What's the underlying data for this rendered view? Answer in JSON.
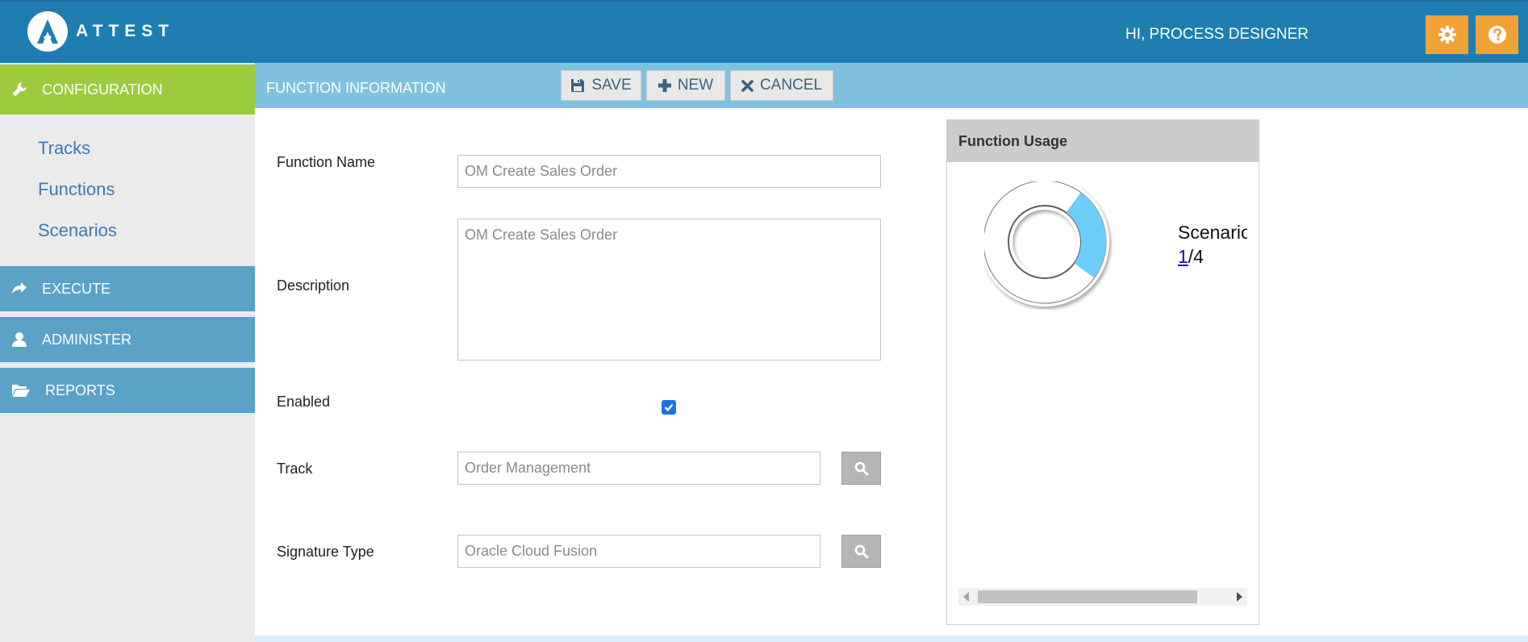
{
  "header": {
    "brand": "ATTEST",
    "greeting": "HI, PROCESS DESIGNER",
    "settings_icon": "gear-icon",
    "help_icon": "help-icon"
  },
  "sidebar": {
    "configuration": "CONFIGURATION",
    "links": [
      "Tracks",
      "Functions",
      "Scenarios"
    ],
    "execute": "EXECUTE",
    "administer": "ADMINISTER",
    "reports": "REPORTS"
  },
  "toolbar": {
    "title": "FUNCTION INFORMATION",
    "save": "SAVE",
    "new": "NEW",
    "cancel": "CANCEL"
  },
  "form": {
    "function_name_label": "Function Name",
    "function_name_value": "OM Create Sales Order",
    "description_label": "Description",
    "description_value": "OM Create Sales Order",
    "enabled_label": "Enabled",
    "enabled": true,
    "track_label": "Track",
    "track_value": "Order Management",
    "signature_label": "Signature Type",
    "signature_value": "Oracle Cloud Fusion"
  },
  "usage": {
    "title": "Function Usage",
    "legend_label": "Scenario",
    "used": "1",
    "total": "/4",
    "fraction": 0.25,
    "colors": {
      "used": "#6ccdf7",
      "unused": "#ffffff"
    }
  }
}
